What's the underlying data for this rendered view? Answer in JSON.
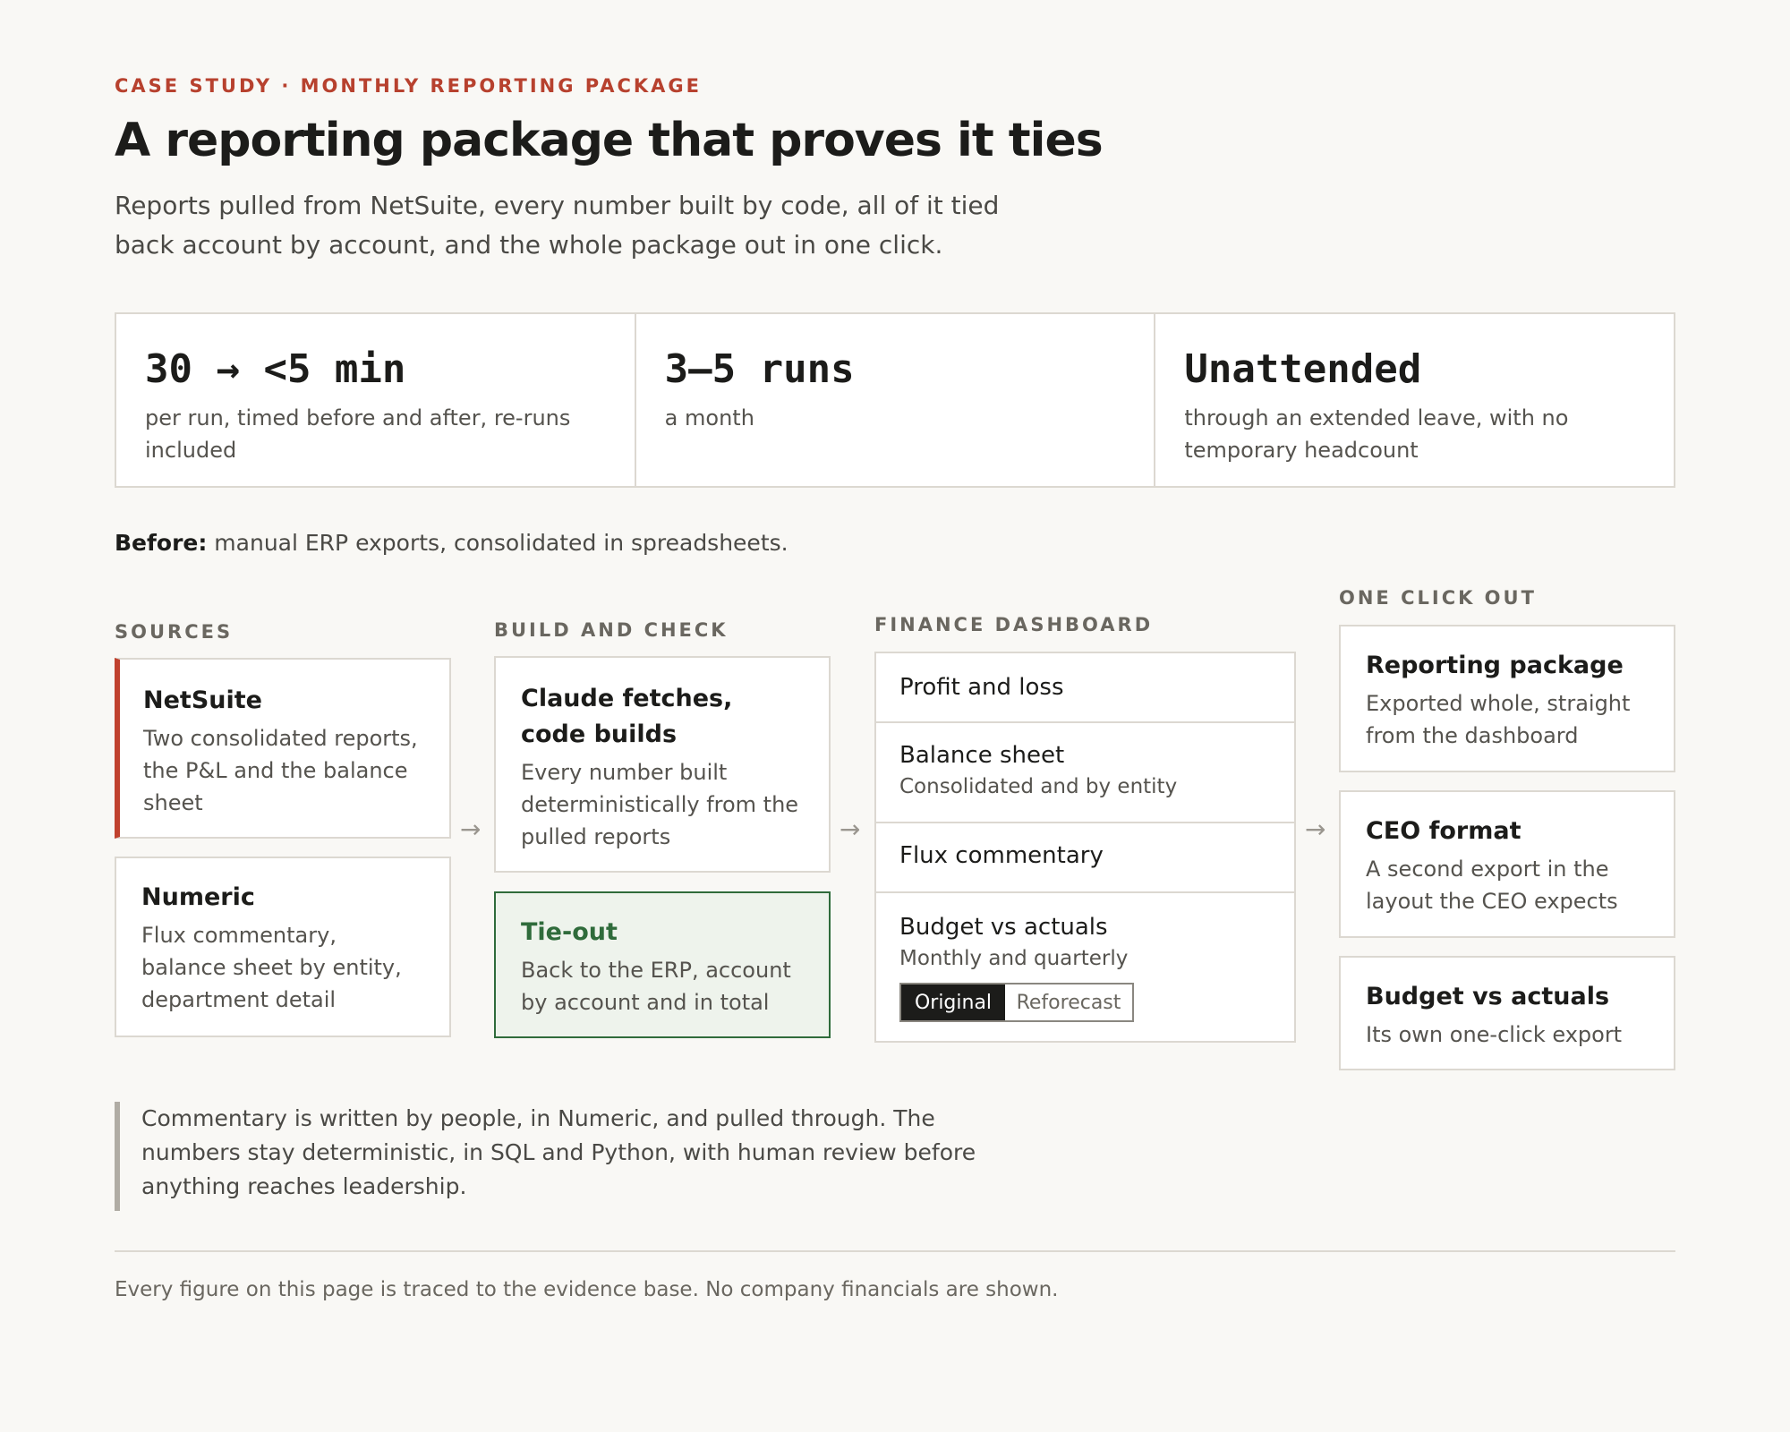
{
  "header": {
    "eyebrow": "CASE STUDY · MONTHLY REPORTING PACKAGE",
    "title": "A reporting package that proves it ties",
    "subtitle": "Reports pulled from NetSuite, every number built by code, all of it tied back account by account, and the whole package out in one click."
  },
  "stats": [
    {
      "value": "30 → <5 min",
      "label": "per run, timed before and after, re-runs included"
    },
    {
      "value": "3–5 runs",
      "label": "a month"
    },
    {
      "value": "Unattended",
      "label": "through an extended leave, with no temporary headcount"
    }
  ],
  "before": {
    "lead": "Before:",
    "text": " manual ERP exports, consolidated in spreadsheets."
  },
  "sources": {
    "heading": "SOURCES",
    "cards": [
      {
        "title": "NetSuite",
        "body": "Two consolidated reports, the P&L and the balance sheet"
      },
      {
        "title": "Numeric",
        "body": "Flux commentary, balance sheet by entity, department detail"
      }
    ]
  },
  "build": {
    "heading": "BUILD AND CHECK",
    "cards": [
      {
        "title": "Claude fetches, code builds",
        "body": "Every number built deterministically from the pulled reports"
      },
      {
        "title": "Tie-out",
        "body": "Back to the ERP, account by account and in total"
      }
    ]
  },
  "dashboard": {
    "heading": "FINANCE DASHBOARD",
    "rows": [
      {
        "label": "Profit and loss"
      },
      {
        "label": "Balance sheet",
        "sub": "Consolidated and by entity"
      },
      {
        "label": "Flux commentary"
      },
      {
        "label": "Budget vs actuals",
        "sub": "Monthly and quarterly"
      }
    ],
    "toggle": {
      "active": "Original",
      "inactive": "Reforecast"
    }
  },
  "outputs": {
    "heading": "ONE CLICK OUT",
    "cards": [
      {
        "title": "Reporting package",
        "body": "Exported whole, straight from the dashboard"
      },
      {
        "title": "CEO format",
        "body": "A second export in the layout the CEO expects"
      },
      {
        "title": "Budget vs actuals",
        "body": "Its own one-click export"
      }
    ]
  },
  "arrow_glyph": "→",
  "quote": "Commentary is written by people, in Numeric, and pulled through. The numbers stay deterministic, in SQL and Python, with human review before anything reaches leadership.",
  "footnote": "Every figure on this page is traced to the evidence base. No company financials are shown.",
  "colors": {
    "accent": "#b7412e",
    "tieout_green": "#2f6b3b",
    "background": "#f9f8f5"
  }
}
